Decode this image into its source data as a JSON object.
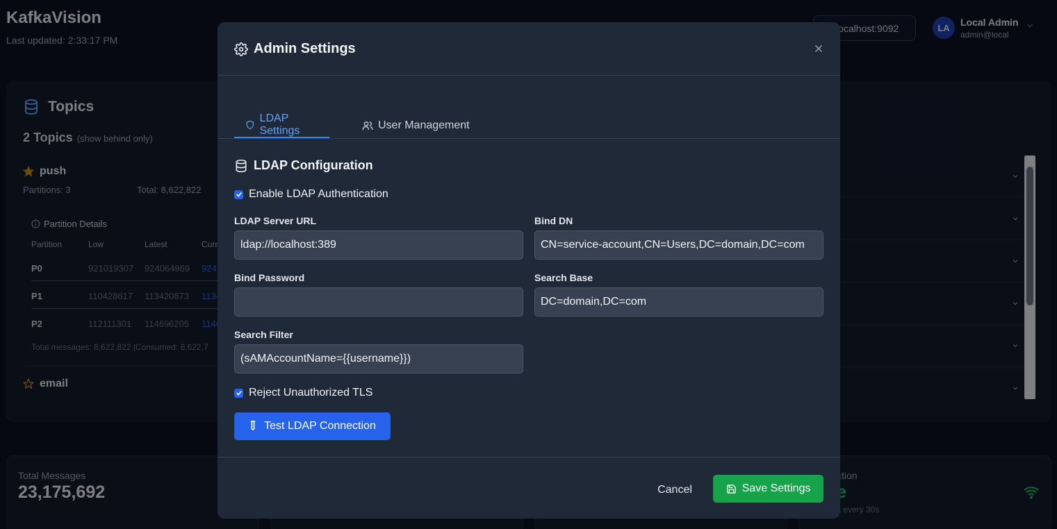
{
  "app": {
    "title": "KafkaVision",
    "last_updated": "Last updated: 2:33:17 PM",
    "broker": "localhost:9092",
    "user": {
      "initials": "LA",
      "name": "Local Admin",
      "email": "admin@local"
    }
  },
  "topics_panel": {
    "title": "Topics",
    "count": "2 Topics",
    "count_hint": "(show behind only)",
    "topics": [
      {
        "name": "push",
        "partitions": "Partitions: 3",
        "total": "Total: 8,622,822"
      },
      {
        "name": "email"
      }
    ],
    "partition_details": {
      "title": "Partition Details",
      "columns": [
        "Partition",
        "Low",
        "Latest",
        "Curr"
      ],
      "rows": [
        {
          "partition": "P0",
          "low": "921019307",
          "latest": "924064969",
          "current": "924"
        },
        {
          "partition": "P1",
          "low": "110428617",
          "latest": "113420873",
          "current": "1134"
        },
        {
          "partition": "P2",
          "low": "112111301",
          "latest": "114696205",
          "current": "1146"
        }
      ],
      "totals": "Total messages: 8,622,822 |Consumed: 8,622,7"
    }
  },
  "stats": {
    "total_messages_label": "Total Messages",
    "total_messages_value": "23,175,692",
    "connection_label": "ction",
    "connection_value": "e",
    "connection_sub": "s every 30s"
  },
  "modal": {
    "title": "Admin Settings",
    "tabs": [
      {
        "label": "LDAP Settings",
        "active": true
      },
      {
        "label": "User Management",
        "active": false
      }
    ],
    "section_title": "LDAP Configuration",
    "enable_ldap": {
      "label": "Enable LDAP Authentication",
      "checked": true
    },
    "fields": {
      "server_url": {
        "label": "LDAP Server URL",
        "value": "ldap://localhost:389"
      },
      "bind_dn": {
        "label": "Bind DN",
        "value": "CN=service-account,CN=Users,DC=domain,DC=com"
      },
      "bind_password": {
        "label": "Bind Password",
        "value": ""
      },
      "search_base": {
        "label": "Search Base",
        "value": "DC=domain,DC=com"
      },
      "search_filter": {
        "label": "Search Filter",
        "value": "(sAMAccountName={{username}})"
      }
    },
    "reject_tls": {
      "label": "Reject Unauthorized TLS",
      "checked": true
    },
    "test_button": "Test LDAP Connection",
    "cancel_button": "Cancel",
    "save_button": "Save Settings"
  },
  "colors": {
    "accent": "#2563eb",
    "success": "#16a34a",
    "modal_bg": "#1f2937",
    "page_bg": "#0b1220"
  }
}
